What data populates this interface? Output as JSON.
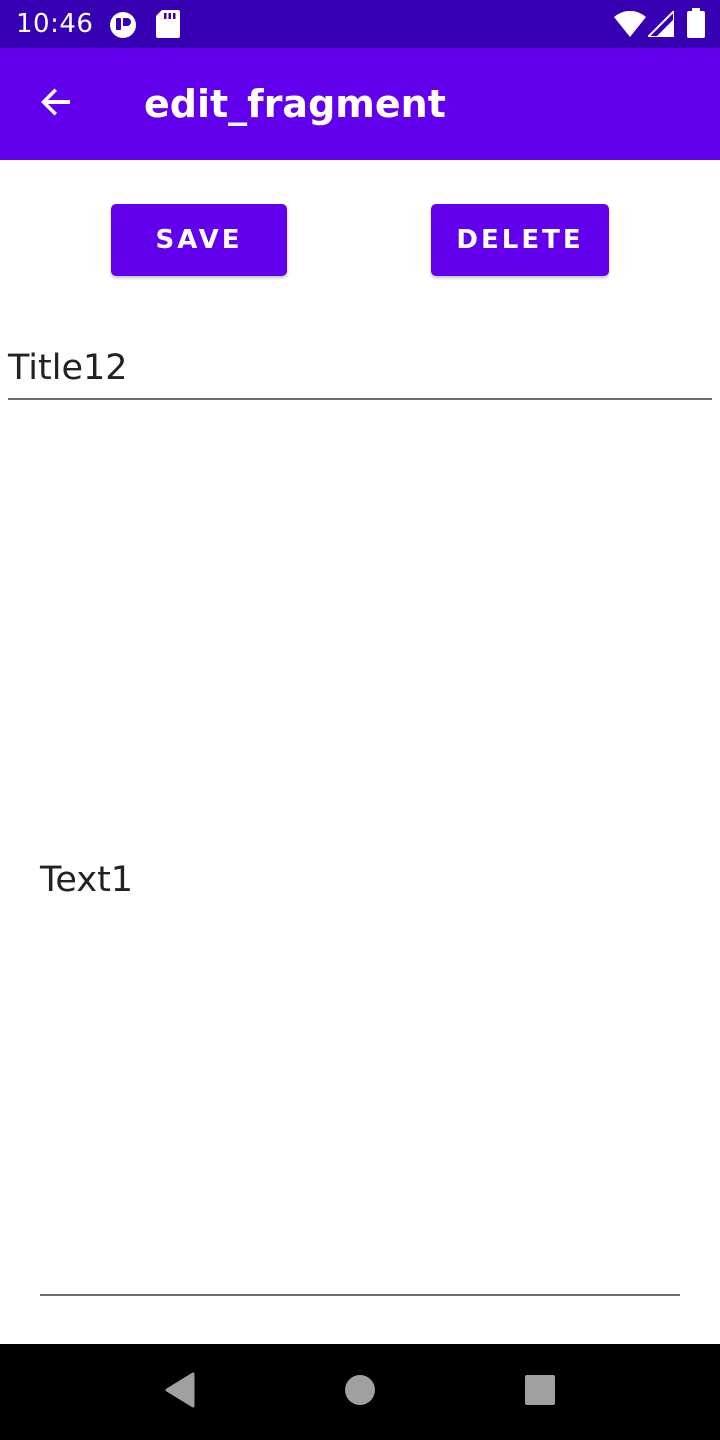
{
  "status_bar": {
    "time": "10:46",
    "icons": [
      "notification-app-icon",
      "sd-card-icon",
      "wifi-icon",
      "cell-signal-icon",
      "battery-icon"
    ]
  },
  "app_bar": {
    "title": "edit_fragment",
    "back_icon": "arrow-back-icon"
  },
  "actions": {
    "save_label": "SAVE",
    "delete_label": "DELETE"
  },
  "form": {
    "title_value": "Title12",
    "body_value": "Text1"
  },
  "nav_bar": {
    "icons": [
      "nav-back-icon",
      "nav-home-icon",
      "nav-recents-icon"
    ]
  },
  "colors": {
    "status_bar": "#3700b3",
    "primary": "#6200ee",
    "on_primary": "#ffffff",
    "text": "#222222",
    "nav_bar": "#000000"
  }
}
